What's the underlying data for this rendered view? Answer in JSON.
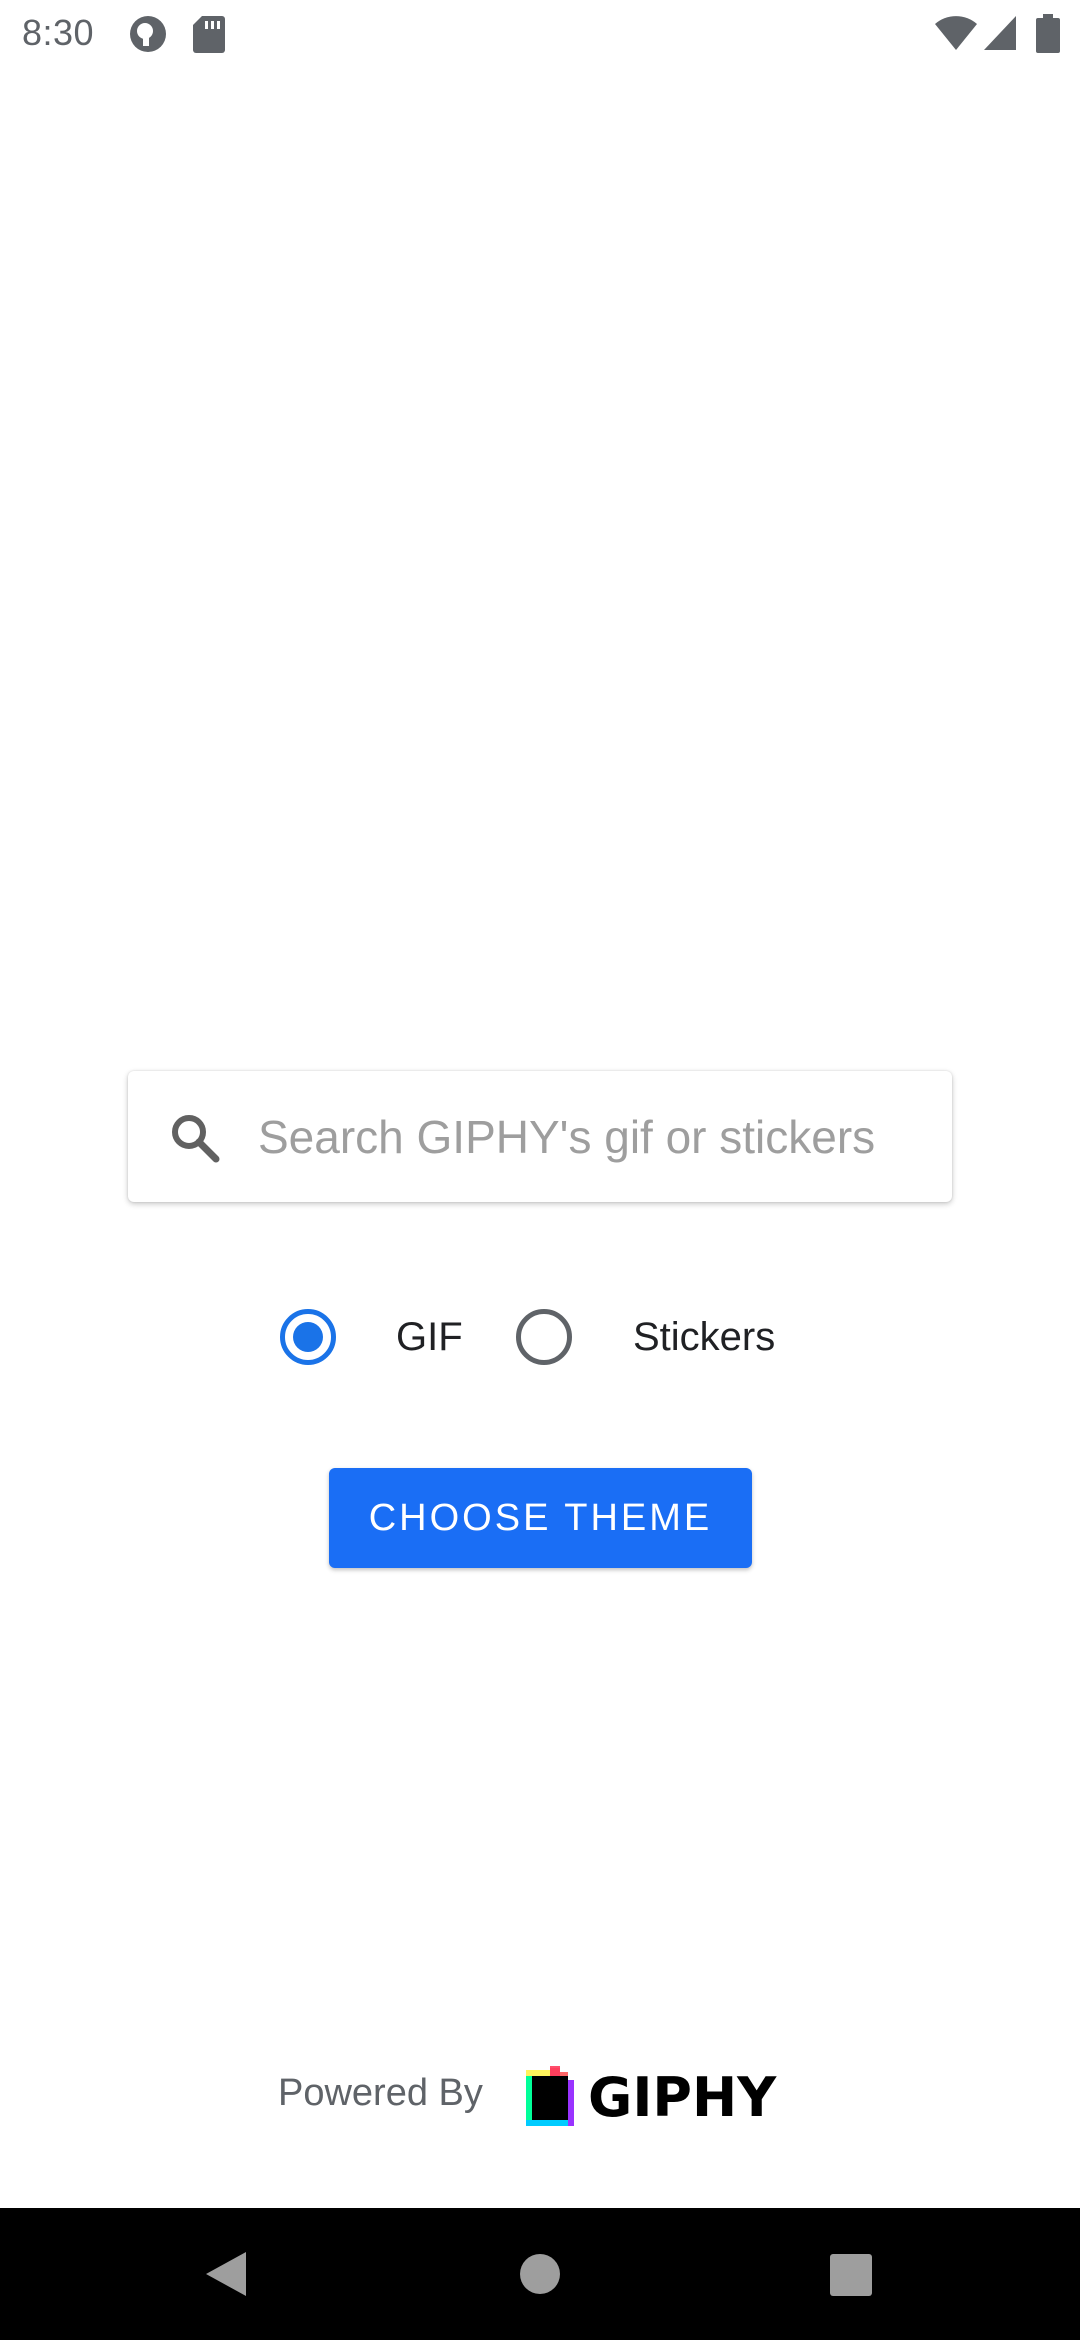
{
  "status_bar": {
    "time": "8:30",
    "left_icons": [
      "privacy-dot-icon",
      "sd-card-icon"
    ],
    "right_icons": [
      "wifi-icon",
      "cell-signal-icon",
      "battery-icon"
    ]
  },
  "search": {
    "placeholder": "Search GIPHY's gif or stickers",
    "value": "",
    "icon": "search-icon"
  },
  "media_type": {
    "selected": "GIF",
    "options": [
      {
        "label": "GIF",
        "checked": true
      },
      {
        "label": "Stickers",
        "checked": false
      }
    ]
  },
  "actions": {
    "choose_theme_label": "CHOOSE THEME"
  },
  "footer": {
    "powered_by": "Powered By",
    "brand": "GIPHY"
  },
  "nav_bar": {
    "buttons": [
      "back-icon",
      "home-icon",
      "recents-icon"
    ]
  },
  "colors": {
    "accent": "#1a73e8",
    "button": "#1a6ef5",
    "placeholder": "#9e9e9e",
    "nav_background": "#000000"
  }
}
